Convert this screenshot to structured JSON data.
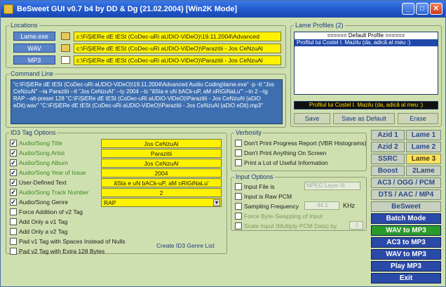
{
  "window": {
    "title": "BeSweet GUI v0.7 b4 by DD & Dg (21.02.2004) [Win2K Mode]",
    "min": "_",
    "max": "□",
    "close": "✕"
  },
  "locations": {
    "legend": "Locations",
    "rows": [
      {
        "label": "Lame.exe",
        "value": "c:\\FiŞiERe dE tESt (CoDec-uRi aUDiO-ViDeO)\\19.11.2004\\Advanced"
      },
      {
        "label": "WAV",
        "value": "c:\\FiŞiERe dE tESt (CoDec-uRi aUDiO-ViDeO)\\Parazitii - Jos CeNzuAl"
      },
      {
        "label": "MP3",
        "value": "c:\\FiŞiERe dE tESt (CoDec-uRi aUDiO-ViDeO)\\Parazitii - Jos CeNzuAl"
      }
    ]
  },
  "lameProfiles": {
    "legend": "Lame Profiles (2)",
    "items": [
      "====== Default Profile ======",
      "Profilul lui Costel I. Mazilu (da, adică al meu :)"
    ],
    "selectedBar": "Profilul lui Costel I. Mazilu (da, adică al meu :)",
    "buttons": {
      "save": "Save",
      "saveDefault": "Save as Default",
      "erase": "Erase"
    }
  },
  "commandLine": {
    "legend": "Command Line",
    "text": "\"c:\\FiŞiERe dE tESt (CoDec-uRi aUDiO-ViDeO)\\19.11.2004\\Advanced Audio Coding\\lame.exe\" -p -tt \"Jos CeNzuAl\" --ta Parazitii --tl \"Jos CeNzuAl\" --ty 2004 --tc \"ăSta e uN bACk-uP, aM oRiGiNaLu'\" --tn 2 --tg RAP --alt-preset 128 \"C:\\FiŞiERe dE tESt (CoDec-uRi aUDiO-ViDeO)\\Parazitii - Jos CeNzuAl (aDiO eDit).wav\" \"C:\\FiŞiERe dE tESt (CoDec-uRi aUDiO-ViDeO)\\Parazitii - Jos CeNzuAl (aDiO eDit).mp3\""
  },
  "id3": {
    "legend": "ID3 Tag Options",
    "fields": [
      {
        "label": "Audio/Song Title",
        "value": "Jos CeNzuAl",
        "checked": true
      },
      {
        "label": "Audio/Song Artist",
        "value": "Parazitii",
        "checked": true
      },
      {
        "label": "Audio/Song Album",
        "value": "Jos CeNzuAl",
        "checked": true
      },
      {
        "label": "Audio/Song Year of Issue",
        "value": "2004",
        "checked": true
      },
      {
        "label": "User-Defined Text",
        "value": "ăSta e uN bACk-uP, aM oRiGiNaLu'",
        "checked": true
      },
      {
        "label": "Audio/Song Track Number",
        "value": "2",
        "checked": true
      },
      {
        "label": "Audio/Song Genre",
        "value": "RAP",
        "checked": true
      }
    ],
    "options": [
      "Force Addition of v2 Tag",
      "Add Only a v1 Tag",
      "Add Only a v2 Tag",
      "Pad v1 Tag with Spaces Instead of Nulls",
      "Pad v2 Tag with Extra 128 Bytes"
    ],
    "genreLink": "Create ID3 Genre List"
  },
  "verbosity": {
    "legend": "Verbosity",
    "options": [
      "Don't Print Progress Report (VBR Histograms)",
      "Don't Print Anything On Screen",
      "Print a Lot of Useful Information"
    ]
  },
  "inputOptions": {
    "legend": "Input Options",
    "inputFileIs": "Input File is",
    "inputFileValue": "MPEG Layer III",
    "rawPcm": "Input is Raw PCM",
    "samplingFreq": "Sampling Frequency",
    "freqValue": "44.1",
    "freqUnit": "KHz",
    "byteSwap": "Force Byte-Swapping of Input",
    "scale": "Scale Input (Multiply PCM Data) by",
    "scaleValue": "1"
  },
  "sidePanel": {
    "rows": [
      [
        "Azid 1",
        "Lame 1"
      ],
      [
        "Azid 2",
        "Lame 2"
      ],
      [
        "SSRC",
        "Lame 3"
      ],
      [
        "Boost",
        "2Lame"
      ]
    ],
    "ac3": "AC3 / OGG / PCM",
    "dts": "DTS / AAC / MP4",
    "besweet": "BeSweet",
    "actions": [
      "Batch Mode",
      "WAV to MP3",
      "AC3 to MP3",
      "WAV to MP3",
      "Play MP3",
      "Exit"
    ]
  }
}
